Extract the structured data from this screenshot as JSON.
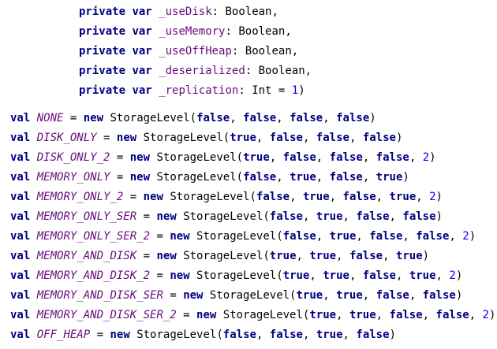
{
  "colors": {
    "keyword": "#000080",
    "field": "#660e7a",
    "number": "#0000ff",
    "text": "#000000",
    "background": "#ffffff"
  },
  "fields": [
    {
      "modifier": "private",
      "keyword": "var",
      "name": "_useDisk",
      "type": ": Boolean,"
    },
    {
      "modifier": "private",
      "keyword": "var",
      "name": "_useMemory",
      "type": ": Boolean,"
    },
    {
      "modifier": "private",
      "keyword": "var",
      "name": "_useOffHeap",
      "type": ": Boolean,"
    },
    {
      "modifier": "private",
      "keyword": "var",
      "name": "_deserialized",
      "type": ": Boolean,"
    },
    {
      "modifier": "private",
      "keyword": "var",
      "name": "_replication",
      "type": ": Int = ",
      "value": "1",
      "close": ")"
    }
  ],
  "levels": [
    {
      "kw": "val",
      "name": "NONE",
      "eq": " = ",
      "new": "new",
      "cls": " StorageLevel(",
      "args": [
        "false",
        "false",
        "false",
        "false"
      ],
      "rep": null
    },
    {
      "kw": "val",
      "name": "DISK_ONLY",
      "eq": " = ",
      "new": "new",
      "cls": " StorageLevel(",
      "args": [
        "true",
        "false",
        "false",
        "false"
      ],
      "rep": null
    },
    {
      "kw": "val",
      "name": "DISK_ONLY_2",
      "eq": " = ",
      "new": "new",
      "cls": " StorageLevel(",
      "args": [
        "true",
        "false",
        "false",
        "false"
      ],
      "rep": "2"
    },
    {
      "kw": "val",
      "name": "MEMORY_ONLY",
      "eq": " = ",
      "new": "new",
      "cls": " StorageLevel(",
      "args": [
        "false",
        "true",
        "false",
        "true"
      ],
      "rep": null
    },
    {
      "kw": "val",
      "name": "MEMORY_ONLY_2",
      "eq": " = ",
      "new": "new",
      "cls": " StorageLevel(",
      "args": [
        "false",
        "true",
        "false",
        "true"
      ],
      "rep": "2"
    },
    {
      "kw": "val",
      "name": "MEMORY_ONLY_SER",
      "eq": " = ",
      "new": "new",
      "cls": " StorageLevel(",
      "args": [
        "false",
        "true",
        "false",
        "false"
      ],
      "rep": null
    },
    {
      "kw": "val",
      "name": "MEMORY_ONLY_SER_2",
      "eq": " = ",
      "new": "new",
      "cls": " StorageLevel(",
      "args": [
        "false",
        "true",
        "false",
        "false"
      ],
      "rep": "2"
    },
    {
      "kw": "val",
      "name": "MEMORY_AND_DISK",
      "eq": " = ",
      "new": "new",
      "cls": " StorageLevel(",
      "args": [
        "true",
        "true",
        "false",
        "true"
      ],
      "rep": null
    },
    {
      "kw": "val",
      "name": "MEMORY_AND_DISK_2",
      "eq": " = ",
      "new": "new",
      "cls": " StorageLevel(",
      "args": [
        "true",
        "true",
        "false",
        "true"
      ],
      "rep": "2"
    },
    {
      "kw": "val",
      "name": "MEMORY_AND_DISK_SER",
      "eq": " = ",
      "new": "new",
      "cls": " StorageLevel(",
      "args": [
        "true",
        "true",
        "false",
        "false"
      ],
      "rep": null
    },
    {
      "kw": "val",
      "name": "MEMORY_AND_DISK_SER_2",
      "eq": " = ",
      "new": "new",
      "cls": " StorageLevel(",
      "args": [
        "true",
        "true",
        "false",
        "false"
      ],
      "rep": "2"
    },
    {
      "kw": "val",
      "name": "OFF_HEAP",
      "eq": " = ",
      "new": "new",
      "cls": " StorageLevel(",
      "args": [
        "false",
        "false",
        "true",
        "false"
      ],
      "rep": null
    }
  ]
}
